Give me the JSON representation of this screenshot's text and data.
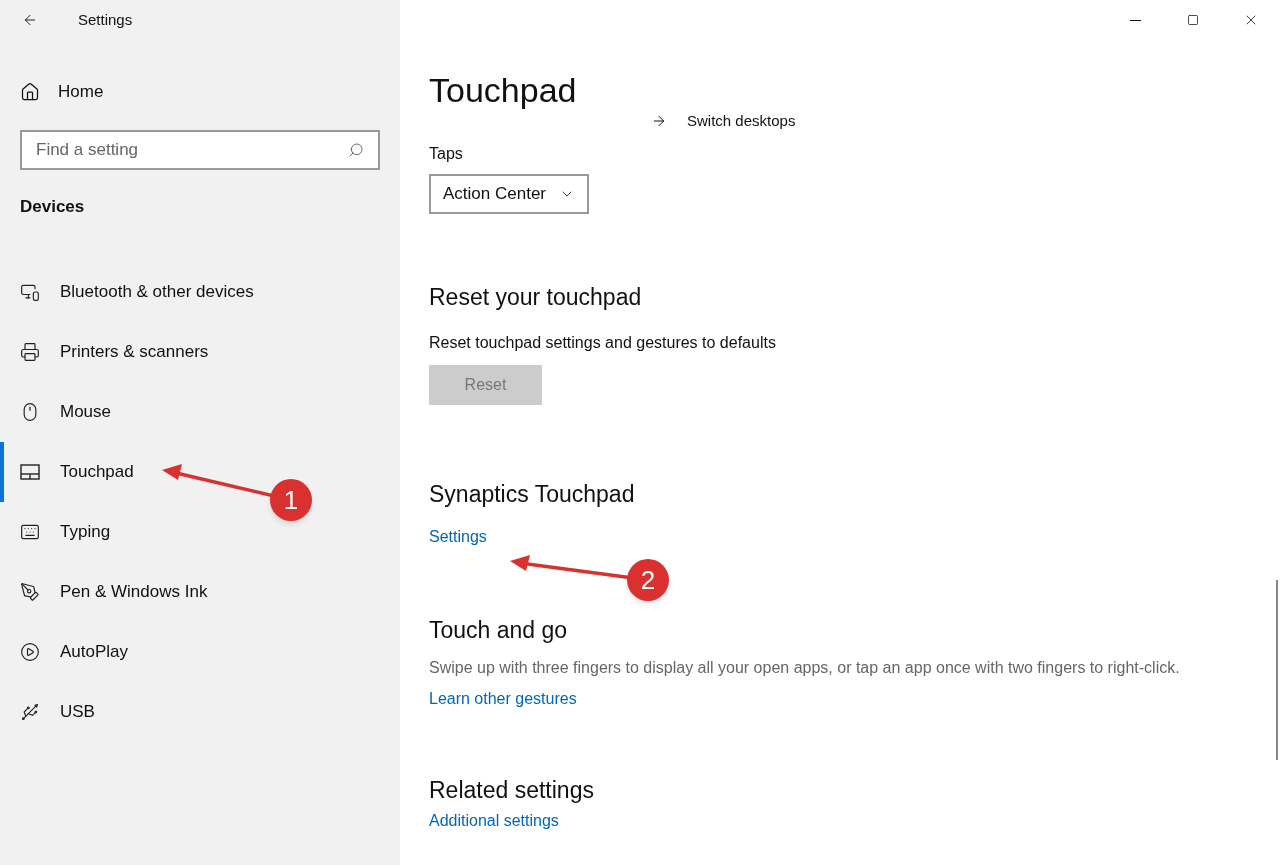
{
  "window": {
    "title": "Settings"
  },
  "sidebar": {
    "home": "Home",
    "search": {
      "placeholder": "Find a setting"
    },
    "section": "Devices",
    "items": [
      {
        "label": "Bluetooth & other devices",
        "kind": "bluetooth",
        "selected": false
      },
      {
        "label": "Printers & scanners",
        "kind": "printer",
        "selected": false
      },
      {
        "label": "Mouse",
        "kind": "mouse",
        "selected": false
      },
      {
        "label": "Touchpad",
        "kind": "touchpad",
        "selected": true
      },
      {
        "label": "Typing",
        "kind": "keyboard",
        "selected": false
      },
      {
        "label": "Pen & Windows Ink",
        "kind": "pen",
        "selected": false
      },
      {
        "label": "AutoPlay",
        "kind": "autoplay",
        "selected": false
      },
      {
        "label": "USB",
        "kind": "usb",
        "selected": false
      }
    ]
  },
  "page": {
    "title": "Touchpad",
    "gesture": "Switch desktops",
    "taps": {
      "label": "Taps",
      "value": "Action Center"
    },
    "reset": {
      "heading": "Reset your touchpad",
      "text": "Reset touchpad settings and gestures to defaults",
      "button": "Reset",
      "disabled": true
    },
    "synaptics": {
      "heading": "Synaptics Touchpad",
      "link": "Settings"
    },
    "touch": {
      "heading": "Touch and go",
      "text": "Swipe up with three fingers to display all your open apps, or tap an app once with two fingers to right-click.",
      "link": "Learn other gestures"
    },
    "related": {
      "heading": "Related settings",
      "link": "Additional settings"
    }
  },
  "annotations": [
    {
      "number": "1"
    },
    {
      "number": "2"
    }
  ]
}
